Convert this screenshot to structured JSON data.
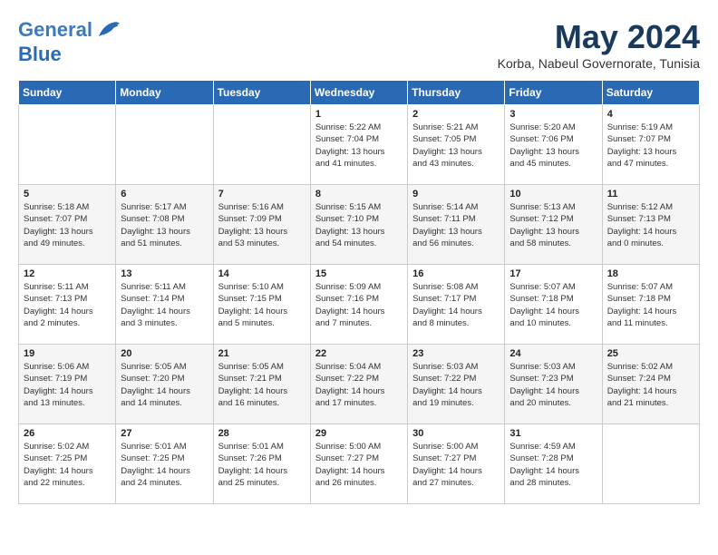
{
  "logo": {
    "line1": "General",
    "line2": "Blue"
  },
  "title": "May 2024",
  "subtitle": "Korba, Nabeul Governorate, Tunisia",
  "days_header": [
    "Sunday",
    "Monday",
    "Tuesday",
    "Wednesday",
    "Thursday",
    "Friday",
    "Saturday"
  ],
  "weeks": [
    [
      {
        "day": "",
        "info": ""
      },
      {
        "day": "",
        "info": ""
      },
      {
        "day": "",
        "info": ""
      },
      {
        "day": "1",
        "info": "Sunrise: 5:22 AM\nSunset: 7:04 PM\nDaylight: 13 hours\nand 41 minutes."
      },
      {
        "day": "2",
        "info": "Sunrise: 5:21 AM\nSunset: 7:05 PM\nDaylight: 13 hours\nand 43 minutes."
      },
      {
        "day": "3",
        "info": "Sunrise: 5:20 AM\nSunset: 7:06 PM\nDaylight: 13 hours\nand 45 minutes."
      },
      {
        "day": "4",
        "info": "Sunrise: 5:19 AM\nSunset: 7:07 PM\nDaylight: 13 hours\nand 47 minutes."
      }
    ],
    [
      {
        "day": "5",
        "info": "Sunrise: 5:18 AM\nSunset: 7:07 PM\nDaylight: 13 hours\nand 49 minutes."
      },
      {
        "day": "6",
        "info": "Sunrise: 5:17 AM\nSunset: 7:08 PM\nDaylight: 13 hours\nand 51 minutes."
      },
      {
        "day": "7",
        "info": "Sunrise: 5:16 AM\nSunset: 7:09 PM\nDaylight: 13 hours\nand 53 minutes."
      },
      {
        "day": "8",
        "info": "Sunrise: 5:15 AM\nSunset: 7:10 PM\nDaylight: 13 hours\nand 54 minutes."
      },
      {
        "day": "9",
        "info": "Sunrise: 5:14 AM\nSunset: 7:11 PM\nDaylight: 13 hours\nand 56 minutes."
      },
      {
        "day": "10",
        "info": "Sunrise: 5:13 AM\nSunset: 7:12 PM\nDaylight: 13 hours\nand 58 minutes."
      },
      {
        "day": "11",
        "info": "Sunrise: 5:12 AM\nSunset: 7:13 PM\nDaylight: 14 hours\nand 0 minutes."
      }
    ],
    [
      {
        "day": "12",
        "info": "Sunrise: 5:11 AM\nSunset: 7:13 PM\nDaylight: 14 hours\nand 2 minutes."
      },
      {
        "day": "13",
        "info": "Sunrise: 5:11 AM\nSunset: 7:14 PM\nDaylight: 14 hours\nand 3 minutes."
      },
      {
        "day": "14",
        "info": "Sunrise: 5:10 AM\nSunset: 7:15 PM\nDaylight: 14 hours\nand 5 minutes."
      },
      {
        "day": "15",
        "info": "Sunrise: 5:09 AM\nSunset: 7:16 PM\nDaylight: 14 hours\nand 7 minutes."
      },
      {
        "day": "16",
        "info": "Sunrise: 5:08 AM\nSunset: 7:17 PM\nDaylight: 14 hours\nand 8 minutes."
      },
      {
        "day": "17",
        "info": "Sunrise: 5:07 AM\nSunset: 7:18 PM\nDaylight: 14 hours\nand 10 minutes."
      },
      {
        "day": "18",
        "info": "Sunrise: 5:07 AM\nSunset: 7:18 PM\nDaylight: 14 hours\nand 11 minutes."
      }
    ],
    [
      {
        "day": "19",
        "info": "Sunrise: 5:06 AM\nSunset: 7:19 PM\nDaylight: 14 hours\nand 13 minutes."
      },
      {
        "day": "20",
        "info": "Sunrise: 5:05 AM\nSunset: 7:20 PM\nDaylight: 14 hours\nand 14 minutes."
      },
      {
        "day": "21",
        "info": "Sunrise: 5:05 AM\nSunset: 7:21 PM\nDaylight: 14 hours\nand 16 minutes."
      },
      {
        "day": "22",
        "info": "Sunrise: 5:04 AM\nSunset: 7:22 PM\nDaylight: 14 hours\nand 17 minutes."
      },
      {
        "day": "23",
        "info": "Sunrise: 5:03 AM\nSunset: 7:22 PM\nDaylight: 14 hours\nand 19 minutes."
      },
      {
        "day": "24",
        "info": "Sunrise: 5:03 AM\nSunset: 7:23 PM\nDaylight: 14 hours\nand 20 minutes."
      },
      {
        "day": "25",
        "info": "Sunrise: 5:02 AM\nSunset: 7:24 PM\nDaylight: 14 hours\nand 21 minutes."
      }
    ],
    [
      {
        "day": "26",
        "info": "Sunrise: 5:02 AM\nSunset: 7:25 PM\nDaylight: 14 hours\nand 22 minutes."
      },
      {
        "day": "27",
        "info": "Sunrise: 5:01 AM\nSunset: 7:25 PM\nDaylight: 14 hours\nand 24 minutes."
      },
      {
        "day": "28",
        "info": "Sunrise: 5:01 AM\nSunset: 7:26 PM\nDaylight: 14 hours\nand 25 minutes."
      },
      {
        "day": "29",
        "info": "Sunrise: 5:00 AM\nSunset: 7:27 PM\nDaylight: 14 hours\nand 26 minutes."
      },
      {
        "day": "30",
        "info": "Sunrise: 5:00 AM\nSunset: 7:27 PM\nDaylight: 14 hours\nand 27 minutes."
      },
      {
        "day": "31",
        "info": "Sunrise: 4:59 AM\nSunset: 7:28 PM\nDaylight: 14 hours\nand 28 minutes."
      },
      {
        "day": "",
        "info": ""
      }
    ]
  ]
}
